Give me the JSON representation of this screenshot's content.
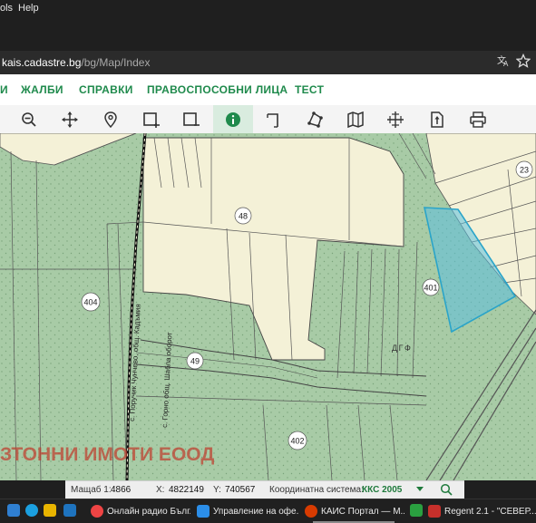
{
  "menubar": {
    "tools": "ols",
    "help": "Help"
  },
  "address": {
    "host": "kais.cadastre.bg",
    "path": "/bg/Map/Index",
    "translate_icon": "translate-icon",
    "star_icon": "star-icon"
  },
  "nav": {
    "items": [
      "И",
      "ЖАЛБИ",
      "СПРАВКИ",
      "ПРАВОСПОСОБНИ ЛИЦА",
      "ТЕСТ"
    ]
  },
  "toolbar": {
    "tools": [
      "zoom-out-icon",
      "pan-icon",
      "location-pin-icon",
      "select-rect-icon",
      "select-rect-alt-icon",
      "info-icon",
      "measure-icon",
      "polygon-icon",
      "map-layers-icon",
      "coordinates-icon",
      "export-icon",
      "print-icon"
    ],
    "active": "info-icon"
  },
  "map": {
    "parcels": [
      "48",
      "401",
      "404",
      "49",
      "402",
      "23"
    ],
    "owner_label": "ДГФ",
    "road_label_1": "с. Поручик Чунчево, общ. Кадъмия",
    "road_label_2": "с. Горно общ. Шабла оборот",
    "overlay_text": "ЗТОННИ ИМОТИ ЕООД"
  },
  "status": {
    "scale_label": "Мащаб 1:",
    "scale_value": "4866",
    "x_label": "X:",
    "x_value": "4822149",
    "y_label": "Y:",
    "y_value": "740567",
    "crs_label": "Координатна система:",
    "crs_value": "ККС 2005"
  },
  "taskbar": {
    "apps": [
      {
        "label": "Онлайн радио Бълг..."
      },
      {
        "label": "Управление на офе..."
      },
      {
        "label": "КАИС Портал — М..."
      },
      {
        "label": "Regent 2.1 - \"СЕВЕР..."
      }
    ]
  },
  "colors": {
    "accent": "#1f8a4c",
    "highlight": "#5bc0de",
    "map_green": "#a8cba6",
    "parcel_fill": "#f4f1d7"
  }
}
